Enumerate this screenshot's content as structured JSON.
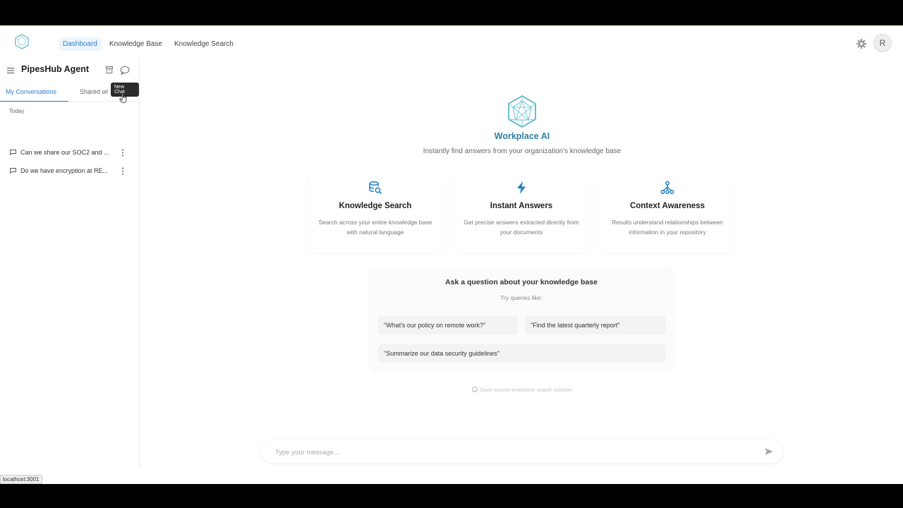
{
  "nav": {
    "links": [
      {
        "label": "Dashboard"
      },
      {
        "label": "Knowledge Base"
      },
      {
        "label": "Knowledge Search"
      }
    ],
    "avatar_initial": "R",
    "accent_color": "#2b7ec9"
  },
  "sidebar": {
    "title": "PipesHub Agent",
    "new_chat_tooltip": "New Chat",
    "tabs": [
      {
        "label": "My Conversations"
      },
      {
        "label": "Shared wi"
      }
    ],
    "section_label": "Today",
    "conversations": [
      {
        "title": "Can we share our SOC2 and ..."
      },
      {
        "title": "Do we have encryption at RE..."
      }
    ]
  },
  "hero": {
    "title": "Workplace AI",
    "subtitle": "Instantly find answers from your organization's knowledge base"
  },
  "features": [
    {
      "icon": "database-search-icon",
      "title": "Knowledge Search",
      "desc": "Search across your entire knowledge base with natural language"
    },
    {
      "icon": "lightning-icon",
      "title": "Instant Answers",
      "desc": "Get precise answers extracted directly from your documents"
    },
    {
      "icon": "hierarchy-icon",
      "title": "Context Awareness",
      "desc": "Results understand relationships between information in your repository"
    }
  ],
  "ask": {
    "title": "Ask a question about your knowledge base",
    "subtitle": "Try queries like:",
    "queries": [
      {
        "text": "\"What's our policy on remote work?\""
      },
      {
        "text": "\"Find the latest quarterly report\""
      },
      {
        "text": "\"Summarize our data security guidelines\""
      }
    ]
  },
  "footer_note": "Open source enterprise search solution",
  "input": {
    "placeholder": "Type your message..."
  },
  "status_url": "localhost:3001"
}
